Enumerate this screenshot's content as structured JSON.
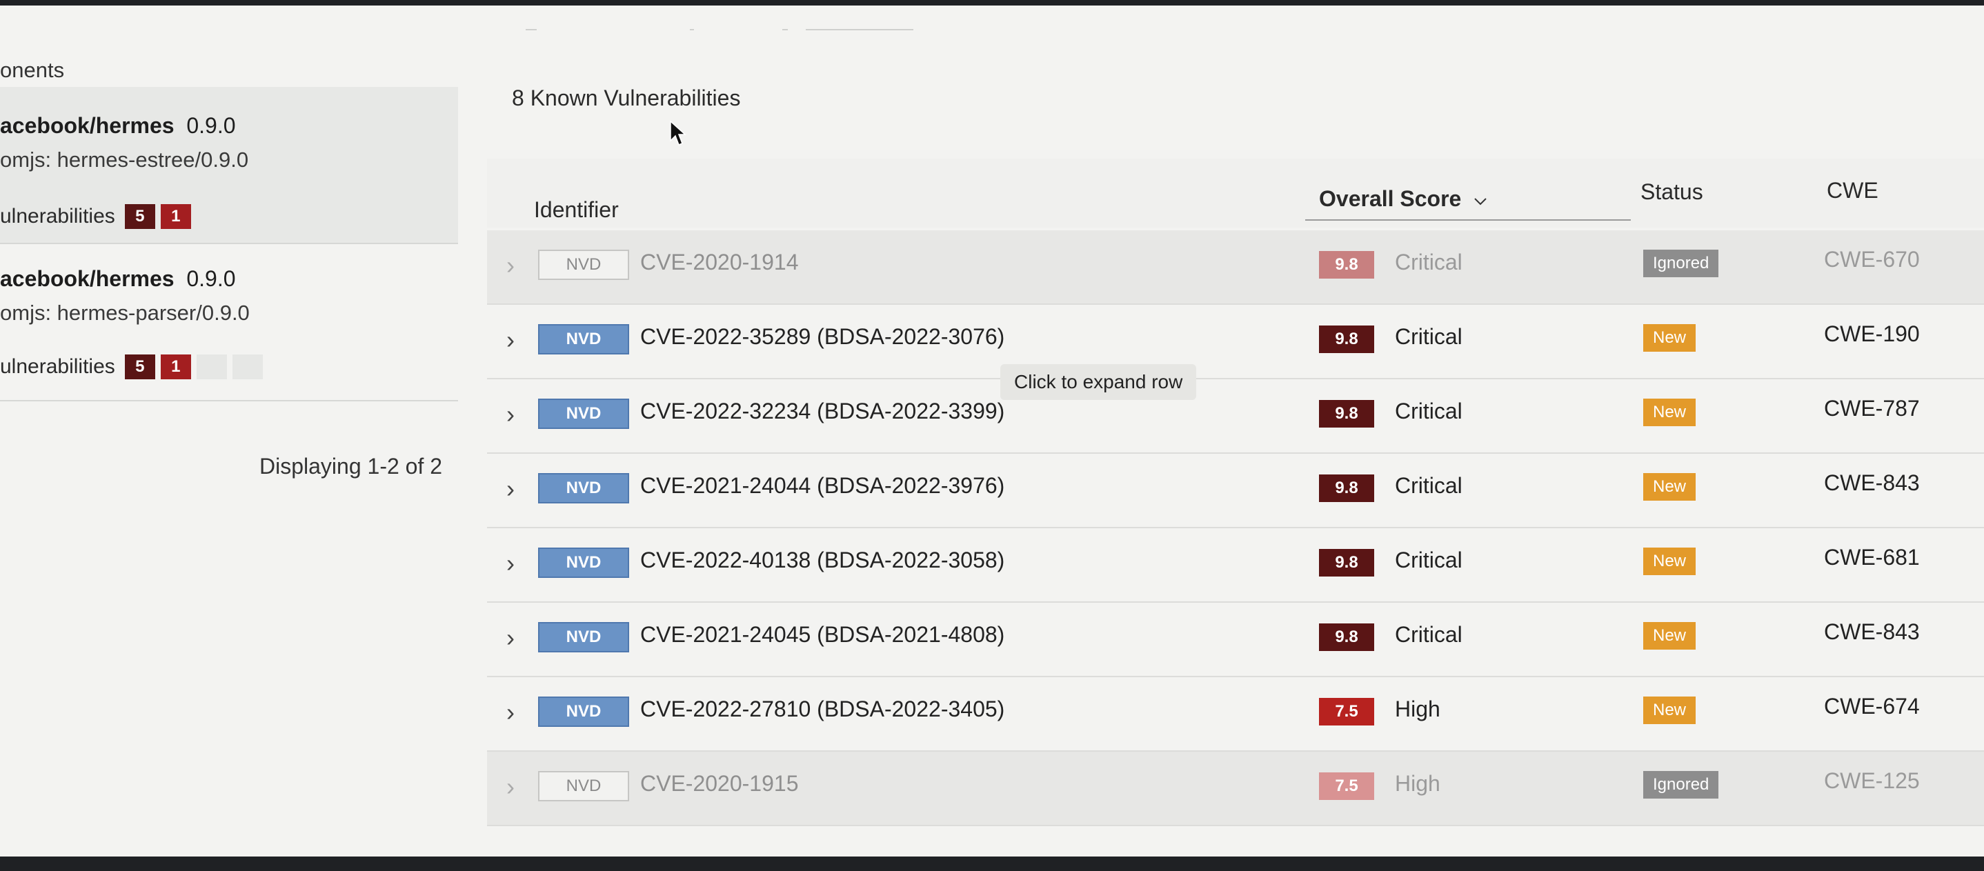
{
  "left_panel": {
    "title": "onents",
    "components": [
      {
        "name_bold": "acebook/hermes",
        "version": "0.9.0",
        "sub": "omjs: hermes-estree/0.9.0",
        "vuln_label": "ulnerabilities",
        "badges": [
          "5",
          "1"
        ]
      },
      {
        "name_bold": "acebook/hermes",
        "version": "0.9.0",
        "sub": "omjs: hermes-parser/0.9.0",
        "vuln_label": "ulnerabilities",
        "badges": [
          "5",
          "1"
        ]
      }
    ],
    "displaying": "Displaying 1-2 of 2"
  },
  "main": {
    "known_count": "8 Known Vulnerabilities",
    "headers": {
      "identifier": "Identifier",
      "overall_score": "Overall Score",
      "status": "Status",
      "cwe": "CWE"
    },
    "tooltip": "Click to expand row",
    "rows": [
      {
        "source": "NVD",
        "id": "CVE-2020-1914",
        "score": "9.8",
        "severity": "Critical",
        "status": "Ignored",
        "cwe": "CWE-670",
        "dim": true
      },
      {
        "source": "NVD",
        "id": "CVE-2022-35289 (BDSA-2022-3076)",
        "score": "9.8",
        "severity": "Critical",
        "status": "New",
        "cwe": "CWE-190",
        "dim": false
      },
      {
        "source": "NVD",
        "id": "CVE-2022-32234 (BDSA-2022-3399)",
        "score": "9.8",
        "severity": "Critical",
        "status": "New",
        "cwe": "CWE-787",
        "dim": false
      },
      {
        "source": "NVD",
        "id": "CVE-2021-24044 (BDSA-2022-3976)",
        "score": "9.8",
        "severity": "Critical",
        "status": "New",
        "cwe": "CWE-843",
        "dim": false
      },
      {
        "source": "NVD",
        "id": "CVE-2022-40138 (BDSA-2022-3058)",
        "score": "9.8",
        "severity": "Critical",
        "status": "New",
        "cwe": "CWE-681",
        "dim": false
      },
      {
        "source": "NVD",
        "id": "CVE-2021-24045 (BDSA-2021-4808)",
        "score": "9.8",
        "severity": "Critical",
        "status": "New",
        "cwe": "CWE-843",
        "dim": false
      },
      {
        "source": "NVD",
        "id": "CVE-2022-27810 (BDSA-2022-3405)",
        "score": "7.5",
        "severity": "High",
        "status": "New",
        "cwe": "CWE-674",
        "dim": false
      },
      {
        "source": "NVD",
        "id": "CVE-2020-1915",
        "score": "7.5",
        "severity": "High",
        "status": "Ignored",
        "cwe": "CWE-125",
        "dim": true
      }
    ]
  },
  "colors": {
    "critical": "#5a1515",
    "high": "#b7221f",
    "new": "#e39a2a",
    "ignored": "#8d8d8d",
    "nvd": "#6a93c6"
  },
  "icons": {
    "expand": "chevron-right-icon",
    "sort": "chevron-down-icon",
    "cursor": "mouse-cursor-icon"
  }
}
